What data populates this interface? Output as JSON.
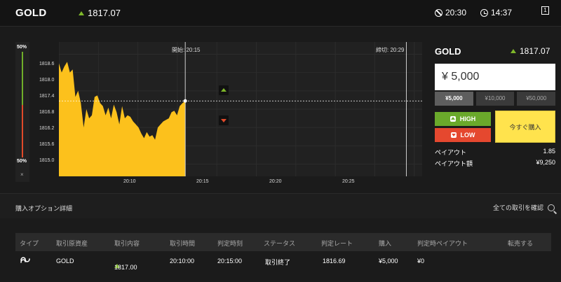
{
  "header": {
    "asset": "GOLD",
    "price": "1817.07",
    "time_remaining": "20:30",
    "clock": "14:37",
    "window_icon_label": "1"
  },
  "chart": {
    "probability_top": "50%",
    "probability_bottom": "50%",
    "probability_up": 50,
    "probability_down": 50,
    "close_label": "×",
    "start_label": "開始: 20:15",
    "end_label": "締切: 20:29",
    "y_ticks": [
      "1818.6",
      "1818.0",
      "1817.4",
      "1816.8",
      "1816.2",
      "1815.6",
      "1815.0"
    ],
    "x_ticks": [
      "20:10",
      "20:15",
      "20:20",
      "20:25"
    ],
    "colors": {
      "area": "#fcc11c",
      "high": "#7fb82a",
      "low": "#e04a2a"
    }
  },
  "chart_data": {
    "type": "area",
    "title": "",
    "xlabel": "",
    "ylabel": "",
    "x_time_range": [
      "20:07",
      "20:30"
    ],
    "ylim": [
      1814.6,
      1819.0
    ],
    "series": [
      {
        "values": [
          1818.3,
          1818.0,
          1818.2,
          1818.35,
          1818.0,
          1818.1,
          1817.2,
          1817.4,
          1817.0,
          1816.2,
          1816.8,
          1816.5,
          1816.6,
          1817.2,
          1817.25,
          1817.0,
          1816.9,
          1816.6,
          1816.85,
          1816.5,
          1816.95,
          1816.7,
          1816.3,
          1816.9,
          1816.5,
          1816.6,
          1816.55,
          1816.4,
          1816.3,
          1816.2,
          1816.0,
          1815.85,
          1816.05,
          1815.9,
          1815.95,
          1815.8,
          1816.2,
          1816.3,
          1816.4,
          1816.45,
          1816.5,
          1816.7,
          1816.75,
          1816.6,
          1816.9,
          1817.0,
          1817.07
        ]
      }
    ],
    "current_price": 1817.07,
    "start_time": "20:15",
    "end_time": "20:29"
  },
  "panel": {
    "asset": "GOLD",
    "price": "1817.07",
    "amount": "¥ 5,000",
    "presets": [
      "¥5,000",
      "¥10,000",
      "¥50,000"
    ],
    "selected_preset": 0,
    "high_label": "HIGH",
    "low_label": "LOW",
    "buy_label": "今すぐ購入",
    "payout_label": "ペイアウト",
    "payout_value": "1.85",
    "payout_amount_label": "ペイアウト額",
    "payout_amount_value": "¥9,250"
  },
  "details": {
    "title": "購入オプション詳細",
    "link": "全ての取引を確認",
    "columns": [
      "タイプ",
      "取引原資産",
      "取引内容",
      "取引時間",
      "判定時刻",
      "ステータス",
      "判定レート",
      "購入",
      "判定時ペイアウト",
      "転売する"
    ],
    "rows": [
      {
        "asset": "GOLD",
        "content": "1817.00",
        "trade_time": "20:10:00",
        "judge_time": "20:15:00",
        "status": "取引終了",
        "rate": "1816.69",
        "purchase": "¥5,000",
        "payout": "¥0",
        "resale": ""
      }
    ]
  }
}
